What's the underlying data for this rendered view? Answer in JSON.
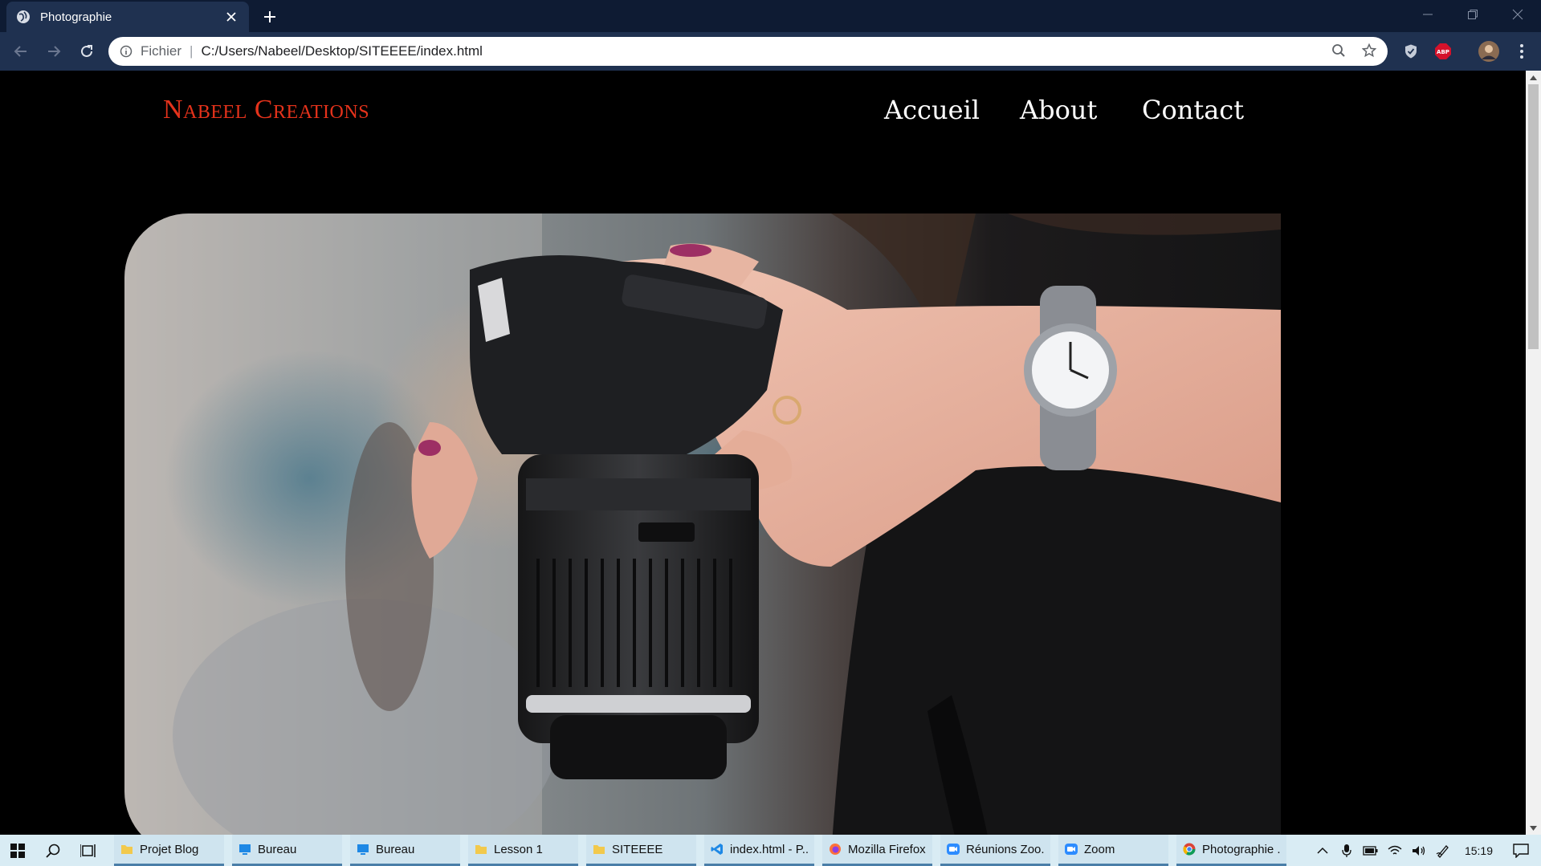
{
  "browser": {
    "tab_title": "Photographie",
    "address": {
      "scheme_label": "Fichier",
      "separator": "|",
      "url": "C:/Users/Nabeel/Desktop/SITEEEE/index.html"
    },
    "extensions": [
      "shield-icon",
      "adblock-plus-icon"
    ],
    "adblock_label": "ABP"
  },
  "page": {
    "brand": "Nabeel Creations",
    "nav": [
      {
        "label": "Accueil"
      },
      {
        "label": "About"
      },
      {
        "label": "Contact"
      }
    ],
    "hero_image": "woman holding camera photo"
  },
  "colors": {
    "brand": "#e4321b",
    "page_bg": "#000000",
    "nav_text": "#ffffff",
    "chrome_dark": "#0e1b33",
    "chrome_toolbar": "#1f3150"
  },
  "taskbar": {
    "items": [
      {
        "label": "Projet Blog",
        "icon": "folder-icon"
      },
      {
        "label": "Bureau",
        "icon": "desktop-icon"
      },
      {
        "label": "Bureau",
        "icon": "desktop-icon"
      },
      {
        "label": "Lesson 1",
        "icon": "folder-icon"
      },
      {
        "label": "SITEEEE",
        "icon": "folder-icon"
      },
      {
        "label": "index.html - P...",
        "icon": "vscode-icon"
      },
      {
        "label": "Mozilla Firefox",
        "icon": "firefox-icon"
      },
      {
        "label": "Réunions Zoo...",
        "icon": "zoom-icon"
      },
      {
        "label": "Zoom",
        "icon": "zoom-icon"
      },
      {
        "label": "Photographie ...",
        "icon": "chrome-icon"
      }
    ],
    "clock": "15:19"
  }
}
